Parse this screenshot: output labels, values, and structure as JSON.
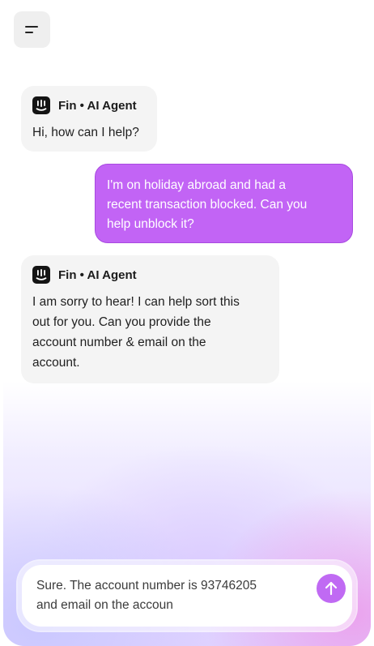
{
  "header": {
    "menu_icon": "menu-icon"
  },
  "messages": [
    {
      "role": "agent",
      "sender": "Fin • AI Agent",
      "avatar_icon": "fin-logo-icon",
      "text": "Hi, how can I help?"
    },
    {
      "role": "user",
      "text": "I'm on holiday abroad and had a\nrecent transaction blocked. Can you\nhelp unblock it?"
    },
    {
      "role": "agent",
      "sender": "Fin • AI Agent",
      "avatar_icon": "fin-logo-icon",
      "text": "I am sorry to hear! I can help sort this\nout for you. Can you provide the\naccount number & email on the\naccount."
    }
  ],
  "composer": {
    "value": "Sure. The account number is 93746205\nand email on the accoun",
    "send_icon": "arrow-up-icon"
  },
  "colors": {
    "user_bubble": "#c264f5",
    "agent_bubble": "#f4f4f4",
    "send_button": "#c06af3"
  }
}
